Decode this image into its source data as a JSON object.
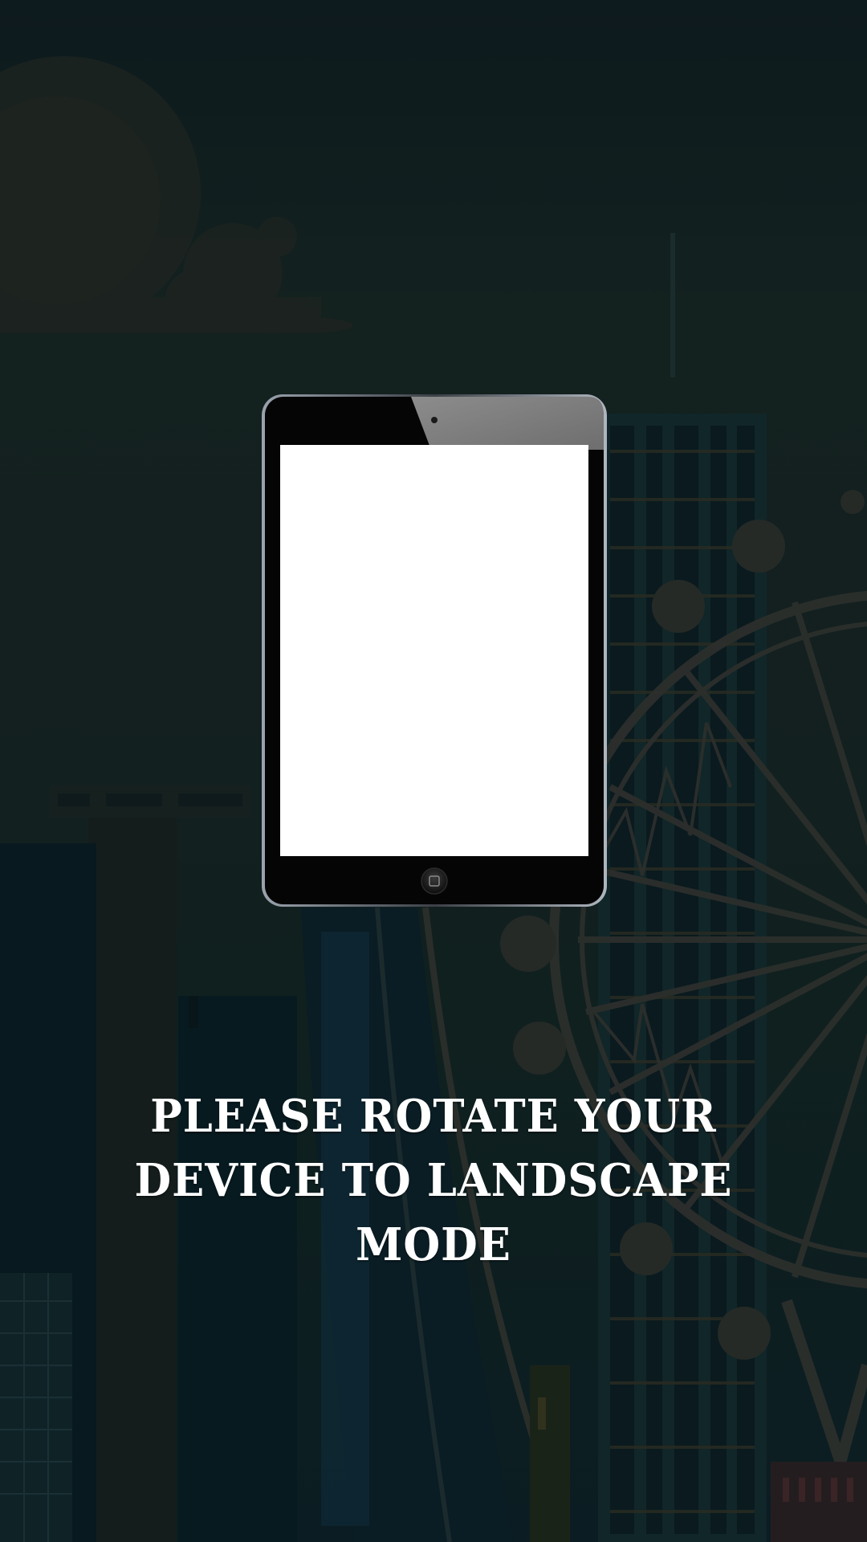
{
  "message": {
    "text": "PLEASE ROTATE YOUR DEVICE TO LANDSCAPE MODE"
  },
  "background": {
    "theme": "night city skyline with ferris wheel",
    "color": "#0f1d20"
  },
  "device": {
    "icon": "tablet-portrait-icon",
    "screen_color": "#ffffff",
    "bezel_color": "#050505"
  }
}
